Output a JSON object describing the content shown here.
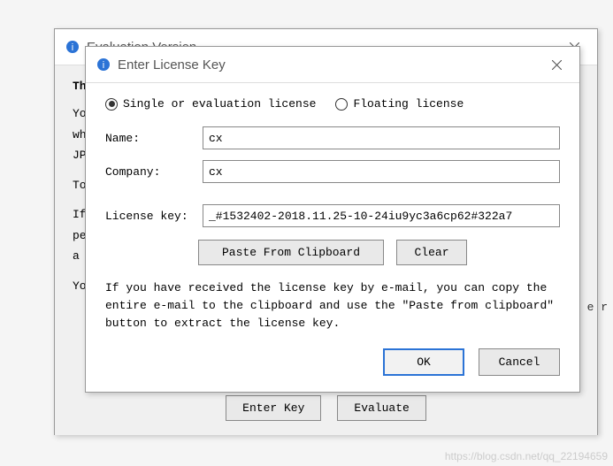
{
  "parent": {
    "title": "Evaluation Version",
    "heading": "Th",
    "lines": [
      "Yo",
      "wh",
      "JP",
      "To",
      "If",
      "pe",
      "a",
      "Yo"
    ],
    "enter_key_btn": "Enter Key",
    "evaluate_btn": "Evaluate"
  },
  "modal": {
    "title": "Enter License Key",
    "radio_single": "Single or evaluation license",
    "radio_floating": "Floating license",
    "name_label": "Name:",
    "name_value": "cx",
    "company_label": "Company:",
    "company_value": "cx",
    "license_label": "License key:",
    "license_value": "_#1532402-2018.11.25-10-24iu9yc3a6cp62#322a7",
    "paste_btn": "Paste From Clipboard",
    "clear_btn": "Clear",
    "help_text": "If you have received the license key by e-mail, you can copy the entire e-mail to the clipboard and use the \"Paste from clipboard\" button to extract the license key.",
    "ok_btn": "OK",
    "cancel_btn": "Cancel"
  },
  "side_text": "e r",
  "watermark": "https://blog.csdn.net/qq_22194659"
}
